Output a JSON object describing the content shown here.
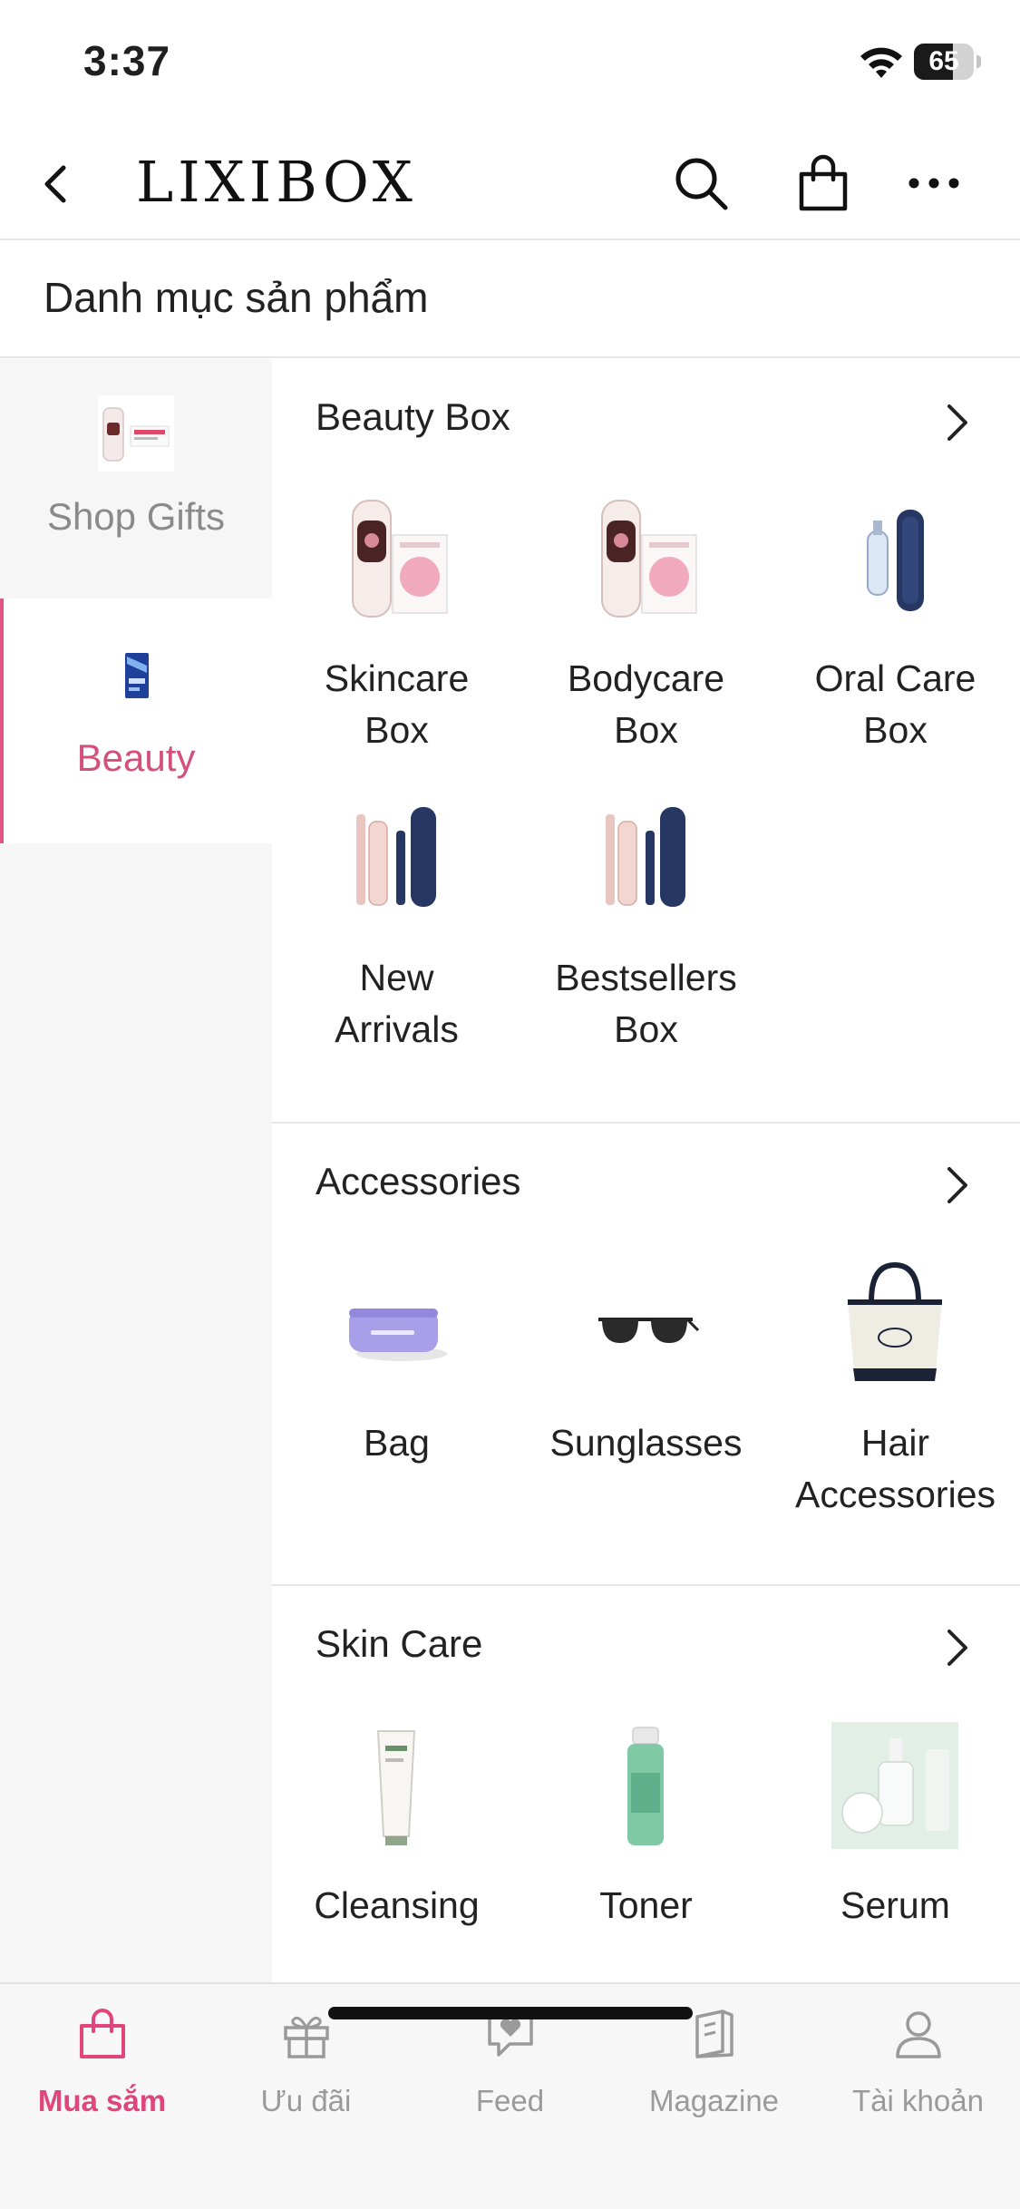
{
  "status": {
    "time": "3:37",
    "battery": "65",
    "battery_level": 0.65
  },
  "header": {
    "brand": "LIXIBOX",
    "icons": [
      "chevron-left-icon",
      "search-icon",
      "shopping-bag-icon",
      "more-horizontal-icon"
    ]
  },
  "page_title": "Danh mục sản phẩm",
  "sidebar": {
    "items": [
      {
        "label": "Shop Gifts",
        "active": false
      },
      {
        "label": "Beauty",
        "active": true
      }
    ]
  },
  "sections": [
    {
      "title": "Beauty Box",
      "items": [
        {
          "line1": "Skincare",
          "line2": "Box"
        },
        {
          "line1": "Bodycare",
          "line2": "Box"
        },
        {
          "line1": "Oral Care",
          "line2": "Box"
        },
        {
          "line1": "New",
          "line2": "Arrivals"
        },
        {
          "line1": "Bestsellers",
          "line2": "Box"
        }
      ]
    },
    {
      "title": "Accessories",
      "items": [
        {
          "line1": "Bag",
          "line2": ""
        },
        {
          "line1": "Sunglasses",
          "line2": ""
        },
        {
          "line1": "Hair",
          "line2": "Accessories"
        }
      ]
    },
    {
      "title": "Skin Care",
      "items": [
        {
          "line1": "Cleansing",
          "line2": ""
        },
        {
          "line1": "Toner",
          "line2": ""
        },
        {
          "line1": "Serum",
          "line2": ""
        }
      ]
    }
  ],
  "bottom_nav": {
    "items": [
      {
        "label": "Mua sắm",
        "icon": "shopping-bag-icon",
        "active": true
      },
      {
        "label": "Ưu đãi",
        "icon": "gift-icon",
        "active": false
      },
      {
        "label": "Feed",
        "icon": "chat-heart-icon",
        "active": false
      },
      {
        "label": "Magazine",
        "icon": "magazine-icon",
        "active": false
      },
      {
        "label": "Tài khoản",
        "icon": "user-icon",
        "active": false
      }
    ]
  },
  "colors": {
    "accent": "#e25585",
    "sidebar_bg": "#f6f6f6",
    "divider": "#e6e6e6"
  }
}
